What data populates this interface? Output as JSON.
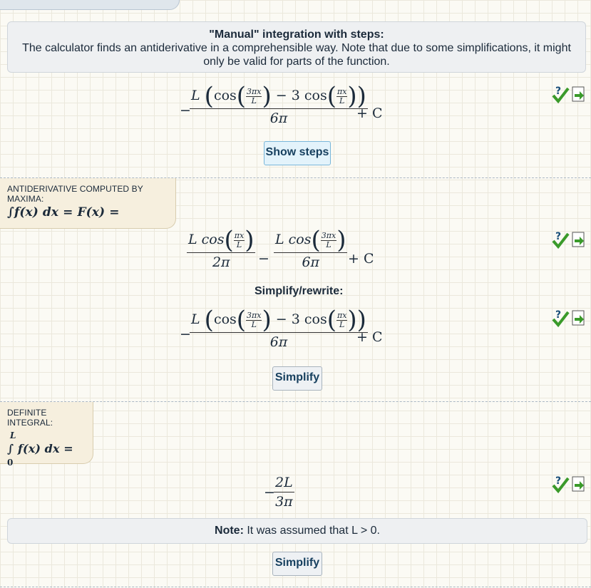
{
  "manual": {
    "title": "\"Manual\" integration with steps:",
    "text": "The calculator finds an antiderivative in a comprehensible way. Note that due to some simplifications, it might only be valid for parts of the function."
  },
  "result1": {
    "minus": "−",
    "L": "L",
    "cos": "cos",
    "frac_a_num": "3πx",
    "frac_a_den": "L",
    "minus3": "− 3 cos",
    "frac_b_num": "πx",
    "frac_b_den": "L",
    "den": "6π",
    "plusC": "+ C"
  },
  "buttons": {
    "show_steps": "Show steps",
    "simplify1": "Simplify",
    "simplify2": "Simplify"
  },
  "maxima": {
    "label": "ANTIDERIVATIVE COMPUTED BY MAXIMA:",
    "formula": "∫f(x) dx = F(x) ="
  },
  "result2": {
    "t1_num_L": "L cos",
    "t1_frac_num": "πx",
    "t1_frac_den": "L",
    "t1_den": "2π",
    "minus": "−",
    "t2_num_L": "L cos",
    "t2_frac_num": "3πx",
    "t2_frac_den": "L",
    "t2_den": "6π",
    "plusC": "+ C"
  },
  "simplify_rewrite": "Simplify/rewrite:",
  "definite": {
    "label": "DEFINITE INTEGRAL:",
    "upper": "L",
    "lower": "0",
    "formula": "∫ f(x) dx ="
  },
  "result4": {
    "minus": "−",
    "num": "2L",
    "den": "3π"
  },
  "note": {
    "bold": "Note:",
    "text": "It was assumed that L > 0."
  },
  "colors": {
    "accent": "#79b7da",
    "check_green": "#3a9a2a",
    "check_icon_blue": "#1a4f7a"
  }
}
